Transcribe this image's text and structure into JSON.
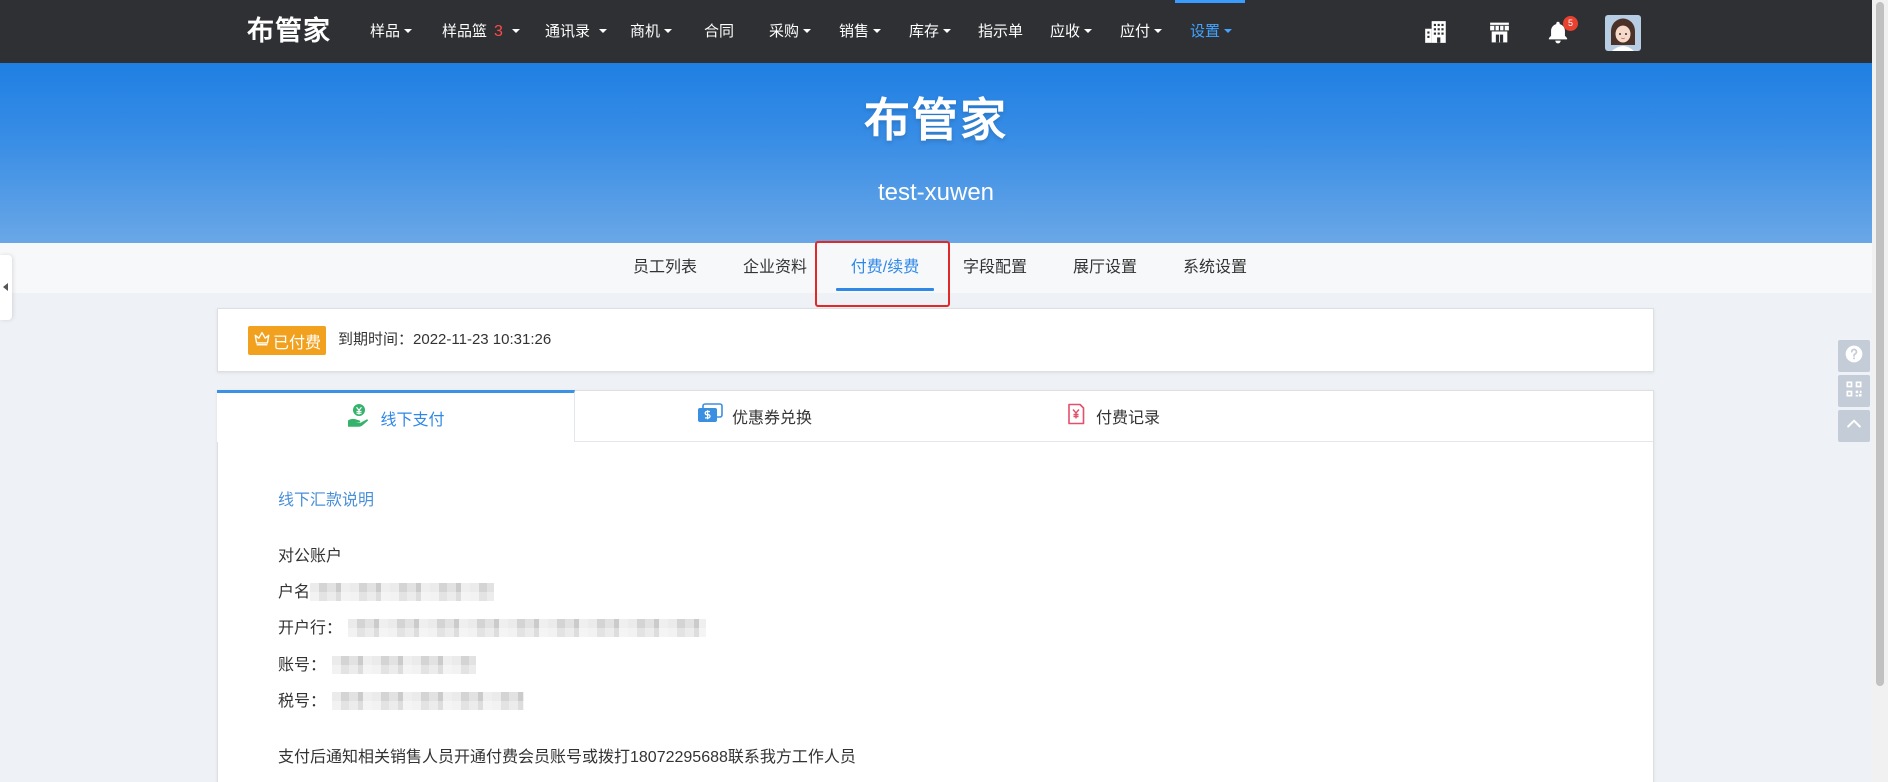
{
  "colors": {
    "topbar": "#2e3033",
    "nav_active": "#43a4ff",
    "accent": "#2f88e8",
    "badge_orange": "#f2a11e",
    "basket_count_red": "#ff4a4a",
    "notification_red": "#e8412f",
    "highlight_red": "#e02a2a",
    "link_blue": "#4a8fd8",
    "offline_icon_green": "#35b36b",
    "coupon_icon_blue": "#3b8fe0",
    "record_icon_red": "#e2506b"
  },
  "header": {
    "logo": "布管家",
    "nav": [
      {
        "label": "样品",
        "has_dropdown": true
      },
      {
        "label": "样品篮",
        "count": "3",
        "has_dropdown": true
      },
      {
        "label": "通讯录",
        "has_dropdown": true
      },
      {
        "label": "商机",
        "has_dropdown": true
      },
      {
        "label": "合同",
        "has_dropdown": false
      },
      {
        "label": "采购",
        "has_dropdown": true
      },
      {
        "label": "销售",
        "has_dropdown": true
      },
      {
        "label": "库存",
        "has_dropdown": true
      },
      {
        "label": "指示单",
        "has_dropdown": false
      },
      {
        "label": "应收",
        "has_dropdown": true
      },
      {
        "label": "应付",
        "has_dropdown": true
      },
      {
        "label": "设置",
        "has_dropdown": true,
        "active": true
      }
    ],
    "tools": [
      {
        "icon": "building-icon"
      },
      {
        "icon": "store-icon"
      },
      {
        "icon": "bell-icon",
        "badge": "5"
      },
      {
        "icon": "avatar"
      }
    ]
  },
  "banner": {
    "title": "布管家",
    "subtitle": "test-xuwen"
  },
  "settings_tabs": [
    {
      "label": "员工列表"
    },
    {
      "label": "企业资料"
    },
    {
      "label": "付费/续费",
      "active": true
    },
    {
      "label": "字段配置"
    },
    {
      "label": "展厅设置"
    },
    {
      "label": "系统设置"
    }
  ],
  "membership": {
    "badge_icon": "crown-icon",
    "badge": "已付费",
    "expiry_label": "到期时间：",
    "expiry_time": "2022-11-23 10:31:26"
  },
  "payment_tabs": [
    {
      "label": "线下支付",
      "icon": "hand-coin-icon",
      "active": true
    },
    {
      "label": "优惠券兑换",
      "icon": "coupon-icon"
    },
    {
      "label": "付费记录",
      "icon": "receipt-icon"
    }
  ],
  "offline_payment": {
    "heading": "线下汇款说明",
    "account_type": "对公账户",
    "fields": [
      {
        "label": "户名",
        "redacted": true
      },
      {
        "label": "开户行：",
        "redacted": true
      },
      {
        "label": "账号：",
        "redacted": true
      },
      {
        "label": "税号：",
        "redacted": true
      }
    ],
    "note": "支付后通知相关销售人员开通付费会员账号或拨打18072295688联系我方工作人员"
  },
  "side_tools": [
    {
      "icon": "help-icon"
    },
    {
      "icon": "qr-code-icon"
    },
    {
      "icon": "back-to-top-icon"
    }
  ],
  "sidebar_toggle": {
    "icon": "chevron-left-icon"
  }
}
